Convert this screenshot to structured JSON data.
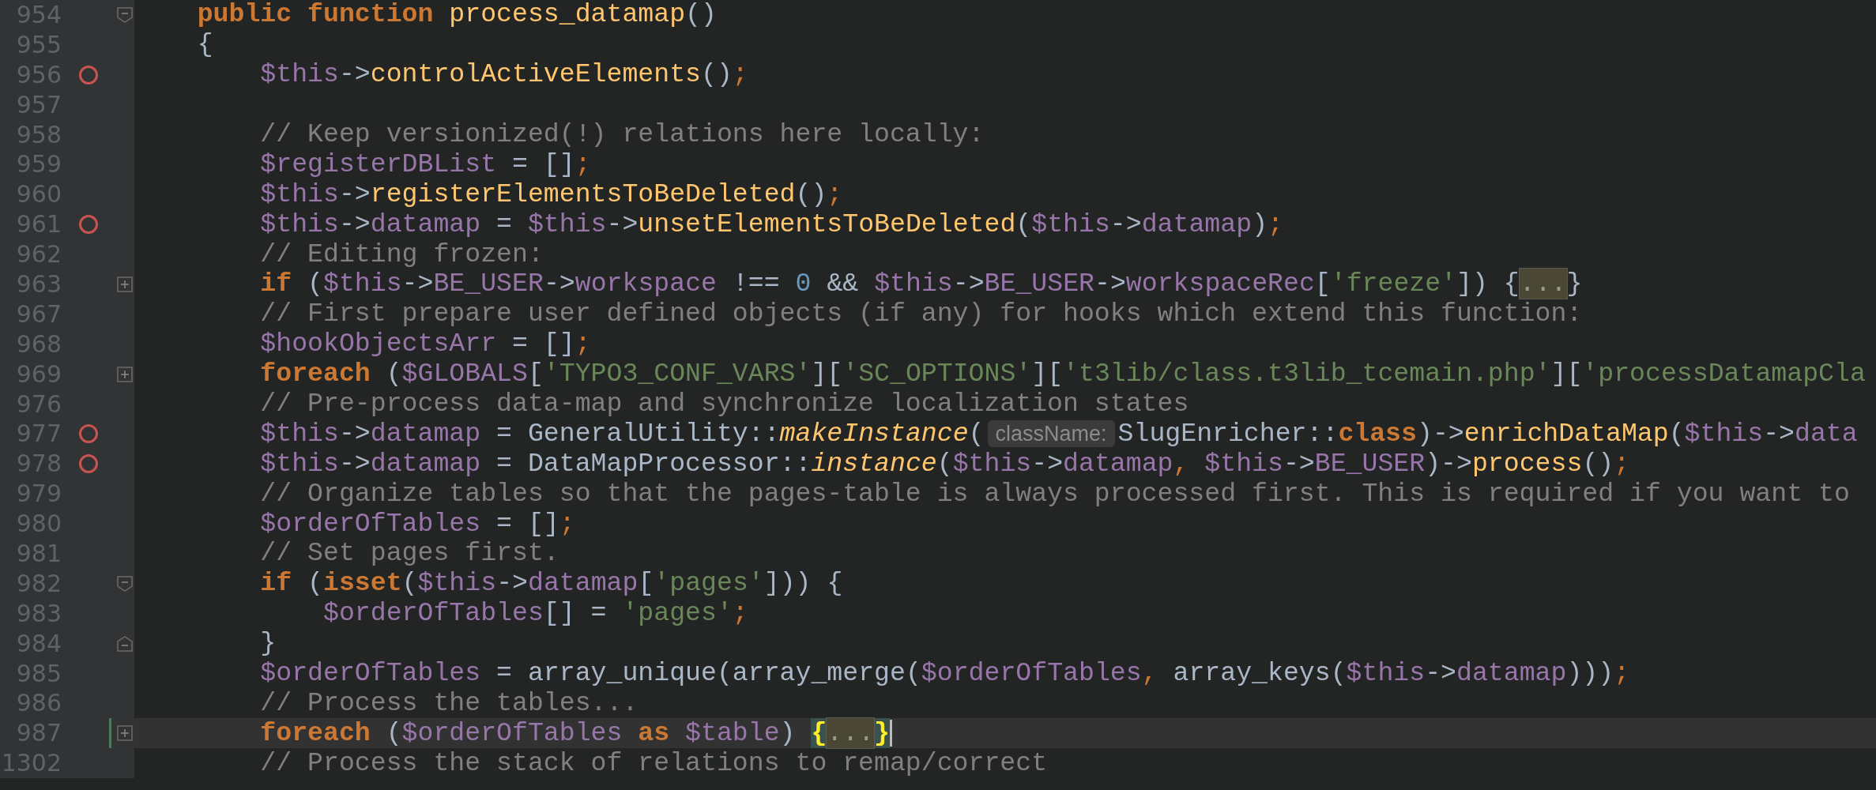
{
  "editor": {
    "lines": [
      {
        "number": "954",
        "breakpoint": false,
        "current": false,
        "modified": false,
        "fold": {
          "kind": "start"
        },
        "tokens": [
          {
            "kind": "kw",
            "text": "    public"
          },
          {
            "kind": "kw",
            "text": " function"
          },
          {
            "kind": "fn",
            "text": " process_datamap"
          },
          {
            "kind": "txt",
            "text": "()"
          }
        ]
      },
      {
        "number": "955",
        "breakpoint": false,
        "current": false,
        "modified": false,
        "tokens": [
          {
            "kind": "txt",
            "text": "    {"
          }
        ]
      },
      {
        "number": "956",
        "breakpoint": true,
        "current": false,
        "modified": false,
        "tokens": [
          {
            "kind": "var",
            "text": "        $this"
          },
          {
            "kind": "txt",
            "text": "->"
          },
          {
            "kind": "fn",
            "text": "controlActiveElements"
          },
          {
            "kind": "txt",
            "text": "()"
          },
          {
            "kind": "semi",
            "text": ";"
          }
        ]
      },
      {
        "number": "957",
        "breakpoint": false,
        "current": false,
        "modified": false
      },
      {
        "number": "958",
        "breakpoint": false,
        "current": false,
        "modified": false,
        "tokens": [
          {
            "kind": "cmt",
            "text": "        // Keep versionized(!) relations here locally:"
          }
        ]
      },
      {
        "number": "959",
        "breakpoint": false,
        "current": false,
        "modified": false,
        "tokens": [
          {
            "kind": "var",
            "text": "        $registerDBList"
          },
          {
            "kind": "txt",
            "text": " = []"
          },
          {
            "kind": "semi",
            "text": ";"
          }
        ]
      },
      {
        "number": "960",
        "breakpoint": false,
        "current": false,
        "modified": false,
        "tokens": [
          {
            "kind": "var",
            "text": "        $this"
          },
          {
            "kind": "txt",
            "text": "->"
          },
          {
            "kind": "fn",
            "text": "registerElementsToBeDeleted"
          },
          {
            "kind": "txt",
            "text": "()"
          },
          {
            "kind": "semi",
            "text": ";"
          }
        ]
      },
      {
        "number": "961",
        "breakpoint": true,
        "current": false,
        "modified": false,
        "tokens": [
          {
            "kind": "var",
            "text": "        $this"
          },
          {
            "kind": "txt",
            "text": "->"
          },
          {
            "kind": "var",
            "text": "datamap"
          },
          {
            "kind": "txt",
            "text": " = "
          },
          {
            "kind": "var",
            "text": "$this"
          },
          {
            "kind": "txt",
            "text": "->"
          },
          {
            "kind": "fn",
            "text": "unsetElementsToBeDeleted"
          },
          {
            "kind": "txt",
            "text": "("
          },
          {
            "kind": "var",
            "text": "$this"
          },
          {
            "kind": "txt",
            "text": "->"
          },
          {
            "kind": "var",
            "text": "datamap"
          },
          {
            "kind": "txt",
            "text": ")"
          },
          {
            "kind": "semi",
            "text": ";"
          }
        ]
      },
      {
        "number": "962",
        "breakpoint": false,
        "current": false,
        "modified": false,
        "tokens": [
          {
            "kind": "cmt",
            "text": "        // Editing frozen:"
          }
        ]
      },
      {
        "number": "963",
        "breakpoint": false,
        "current": false,
        "modified": false,
        "fold": {
          "kind": "collapsed"
        },
        "tokens": [
          {
            "kind": "kw",
            "text": "        if"
          },
          {
            "kind": "txt",
            "text": " ("
          },
          {
            "kind": "var",
            "text": "$this"
          },
          {
            "kind": "txt",
            "text": "->"
          },
          {
            "kind": "var",
            "text": "BE_USER"
          },
          {
            "kind": "txt",
            "text": "->"
          },
          {
            "kind": "var",
            "text": "workspace"
          },
          {
            "kind": "txt",
            "text": " !== "
          },
          {
            "kind": "num",
            "text": "0"
          },
          {
            "kind": "txt",
            "text": " && "
          },
          {
            "kind": "var",
            "text": "$this"
          },
          {
            "kind": "txt",
            "text": "->"
          },
          {
            "kind": "var",
            "text": "BE_USER"
          },
          {
            "kind": "txt",
            "text": "->"
          },
          {
            "kind": "var",
            "text": "workspaceRec"
          },
          {
            "kind": "txt",
            "text": "["
          },
          {
            "kind": "str",
            "text": "'freeze'"
          },
          {
            "kind": "txt",
            "text": "]) {"
          },
          {
            "kind": "fold",
            "text": "..."
          },
          {
            "kind": "txt",
            "text": "}"
          }
        ]
      },
      {
        "number": "967",
        "breakpoint": false,
        "current": false,
        "modified": false,
        "tokens": [
          {
            "kind": "cmt",
            "text": "        // First prepare user defined objects (if any) for hooks which extend this function:"
          }
        ]
      },
      {
        "number": "968",
        "breakpoint": false,
        "current": false,
        "modified": false,
        "tokens": [
          {
            "kind": "var",
            "text": "        $hookObjectsArr"
          },
          {
            "kind": "txt",
            "text": " = []"
          },
          {
            "kind": "semi",
            "text": ";"
          }
        ]
      },
      {
        "number": "969",
        "breakpoint": false,
        "current": false,
        "modified": false,
        "fold": {
          "kind": "collapsed"
        },
        "tokens": [
          {
            "kind": "kw",
            "text": "        foreach"
          },
          {
            "kind": "txt",
            "text": " ("
          },
          {
            "kind": "var",
            "text": "$GLOBALS"
          },
          {
            "kind": "txt",
            "text": "["
          },
          {
            "kind": "str",
            "text": "'TYPO3_CONF_VARS'"
          },
          {
            "kind": "txt",
            "text": "]["
          },
          {
            "kind": "str",
            "text": "'SC_OPTIONS'"
          },
          {
            "kind": "txt",
            "text": "]["
          },
          {
            "kind": "str",
            "text": "'t3lib/class.t3lib_tcemain.php'"
          },
          {
            "kind": "txt",
            "text": "]["
          },
          {
            "kind": "str",
            "text": "'processDatamapCla"
          }
        ]
      },
      {
        "number": "976",
        "breakpoint": false,
        "current": false,
        "modified": false,
        "tokens": [
          {
            "kind": "cmt",
            "text": "        // Pre-process data-map and synchronize localization states"
          }
        ]
      },
      {
        "number": "977",
        "breakpoint": true,
        "current": false,
        "modified": false,
        "tokens": [
          {
            "kind": "var",
            "text": "        $this"
          },
          {
            "kind": "txt",
            "text": "->"
          },
          {
            "kind": "var",
            "text": "datamap"
          },
          {
            "kind": "txt",
            "text": " = GeneralUtility::"
          },
          {
            "kind": "fni",
            "text": "makeInstance"
          },
          {
            "kind": "txt",
            "text": "("
          },
          {
            "kind": "hint",
            "text": "className:"
          },
          {
            "kind": "txt",
            "text": "SlugEnricher::"
          },
          {
            "kind": "kw",
            "text": "class"
          },
          {
            "kind": "txt",
            "text": ")->"
          },
          {
            "kind": "fn",
            "text": "enrichDataMap"
          },
          {
            "kind": "txt",
            "text": "("
          },
          {
            "kind": "var",
            "text": "$this"
          },
          {
            "kind": "txt",
            "text": "->"
          },
          {
            "kind": "var",
            "text": "data"
          }
        ]
      },
      {
        "number": "978",
        "breakpoint": true,
        "current": false,
        "modified": false,
        "tokens": [
          {
            "kind": "var",
            "text": "        $this"
          },
          {
            "kind": "txt",
            "text": "->"
          },
          {
            "kind": "var",
            "text": "datamap"
          },
          {
            "kind": "txt",
            "text": " = DataMapProcessor::"
          },
          {
            "kind": "fni",
            "text": "instance"
          },
          {
            "kind": "txt",
            "text": "("
          },
          {
            "kind": "var",
            "text": "$this"
          },
          {
            "kind": "txt",
            "text": "->"
          },
          {
            "kind": "var",
            "text": "datamap"
          },
          {
            "kind": "semi",
            "text": ","
          },
          {
            "kind": "var",
            "text": " $this"
          },
          {
            "kind": "txt",
            "text": "->"
          },
          {
            "kind": "var",
            "text": "BE_USER"
          },
          {
            "kind": "txt",
            "text": ")->"
          },
          {
            "kind": "fn",
            "text": "process"
          },
          {
            "kind": "txt",
            "text": "()"
          },
          {
            "kind": "semi",
            "text": ";"
          }
        ]
      },
      {
        "number": "979",
        "breakpoint": false,
        "current": false,
        "modified": false,
        "tokens": [
          {
            "kind": "cmt",
            "text": "        // Organize tables so that the pages-table is always processed first. This is required if you want to"
          }
        ]
      },
      {
        "number": "980",
        "breakpoint": false,
        "current": false,
        "modified": false,
        "tokens": [
          {
            "kind": "var",
            "text": "        $orderOfTables"
          },
          {
            "kind": "txt",
            "text": " = []"
          },
          {
            "kind": "semi",
            "text": ";"
          }
        ]
      },
      {
        "number": "981",
        "breakpoint": false,
        "current": false,
        "modified": false,
        "tokens": [
          {
            "kind": "cmt",
            "text": "        // Set pages first."
          }
        ]
      },
      {
        "number": "982",
        "breakpoint": false,
        "current": false,
        "modified": false,
        "fold": {
          "kind": "start"
        },
        "tokens": [
          {
            "kind": "kw",
            "text": "        if"
          },
          {
            "kind": "txt",
            "text": " ("
          },
          {
            "kind": "kw",
            "text": "isset"
          },
          {
            "kind": "txt",
            "text": "("
          },
          {
            "kind": "var",
            "text": "$this"
          },
          {
            "kind": "txt",
            "text": "->"
          },
          {
            "kind": "var",
            "text": "datamap"
          },
          {
            "kind": "txt",
            "text": "["
          },
          {
            "kind": "str",
            "text": "'pages'"
          },
          {
            "kind": "txt",
            "text": "])) {"
          }
        ]
      },
      {
        "number": "983",
        "breakpoint": false,
        "current": false,
        "modified": false,
        "tokens": [
          {
            "kind": "var",
            "text": "            $orderOfTables"
          },
          {
            "kind": "txt",
            "text": "[] = "
          },
          {
            "kind": "str",
            "text": "'pages'"
          },
          {
            "kind": "semi",
            "text": ";"
          }
        ]
      },
      {
        "number": "984",
        "breakpoint": false,
        "current": false,
        "modified": false,
        "fold": {
          "kind": "end"
        },
        "tokens": [
          {
            "kind": "txt",
            "text": "        }"
          }
        ]
      },
      {
        "number": "985",
        "breakpoint": false,
        "current": false,
        "modified": false,
        "tokens": [
          {
            "kind": "var",
            "text": "        $orderOfTables"
          },
          {
            "kind": "txt",
            "text": " = array_unique(array_merge("
          },
          {
            "kind": "var",
            "text": "$orderOfTables"
          },
          {
            "kind": "semi",
            "text": ","
          },
          {
            "kind": "txt",
            "text": " array_keys("
          },
          {
            "kind": "var",
            "text": "$this"
          },
          {
            "kind": "txt",
            "text": "->"
          },
          {
            "kind": "var",
            "text": "datamap"
          },
          {
            "kind": "txt",
            "text": ")))"
          },
          {
            "kind": "semi",
            "text": ";"
          }
        ]
      },
      {
        "number": "986",
        "breakpoint": false,
        "current": false,
        "modified": false,
        "tokens": [
          {
            "kind": "cmt",
            "text": "        // Process the tables..."
          }
        ]
      },
      {
        "number": "987",
        "breakpoint": false,
        "current": true,
        "modified": true,
        "fold": {
          "kind": "collapsed"
        },
        "tokens": [
          {
            "kind": "kw",
            "text": "        foreach"
          },
          {
            "kind": "txt",
            "text": " ("
          },
          {
            "kind": "var",
            "text": "$orderOfTables"
          },
          {
            "kind": "kw",
            "text": " as"
          },
          {
            "kind": "var",
            "text": " $table"
          },
          {
            "kind": "txt",
            "text": ") "
          },
          {
            "kind": "brace",
            "text": "{"
          },
          {
            "kind": "fold",
            "text": "..."
          },
          {
            "kind": "brace",
            "text": "}"
          }
        ]
      },
      {
        "number": "1302",
        "breakpoint": false,
        "current": false,
        "modified": false,
        "tokens": [
          {
            "kind": "cmt",
            "text": "        // Process the stack of relations to remap/correct"
          }
        ]
      }
    ]
  }
}
